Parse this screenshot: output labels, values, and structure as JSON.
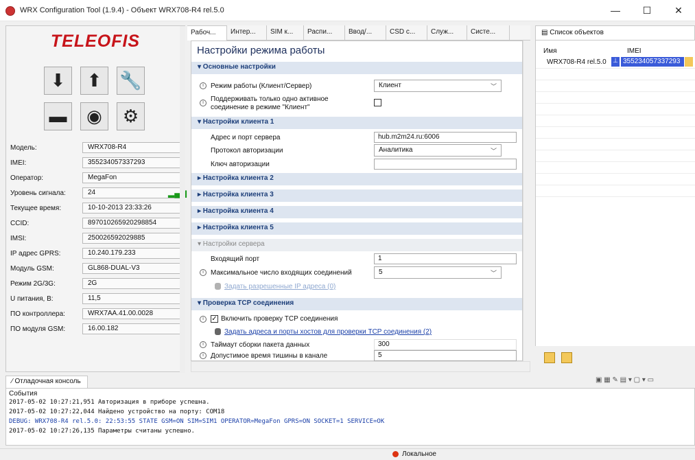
{
  "window": {
    "title": "WRX Configuration Tool (1.9.4) - Объект WRX708-R4 rel.5.0",
    "minimize": "—",
    "maximize": "☐",
    "close": "✕"
  },
  "left_panel": {
    "logo": "TELEOFIS",
    "info": [
      {
        "label": "Модель:",
        "value": "WRX708-R4"
      },
      {
        "label": "IMEI:",
        "value": "355234057337293"
      },
      {
        "label": "Оператор:",
        "value": "MegaFon"
      },
      {
        "label": "Уровень сигнала:",
        "value": "24"
      },
      {
        "label": "Текущее время:",
        "value": "10-10-2013 23:33:26"
      },
      {
        "label": "CCID:",
        "value": "897010265920298854"
      },
      {
        "label": "IMSI:",
        "value": "250026592029885"
      },
      {
        "label": "IP адрес GPRS:",
        "value": "10.240.179.233"
      },
      {
        "label": "Модуль GSM:",
        "value": "GL868-DUAL-V3"
      },
      {
        "label": "Режим 2G/3G:",
        "value": "2G"
      },
      {
        "label": "U питания, В:",
        "value": "11,5"
      },
      {
        "label": "ПО контроллера:",
        "value": "WRX7AA.41.00.0028"
      },
      {
        "label": "ПО модуля GSM:",
        "value": "16.00.182"
      }
    ]
  },
  "tabs": [
    "Рабоч...",
    "Интер...",
    "SIM к...",
    "Распи...",
    "Ввод/...",
    "CSD с...",
    "Служ...",
    "Систе..."
  ],
  "settings": {
    "title": "Настройки режима работы",
    "sections": {
      "basic": "▾ Основные настройки",
      "client1": "▾ Настройки клиента 1",
      "client2": "▸ Настройка клиента 2",
      "client3": "▸ Настройка клиента 3",
      "client4": "▸ Настройка клиента 4",
      "client5": "▸ Настройка клиента 5",
      "server": "▾ Настройки сервера",
      "tcp": "▾ Проверка TCP соединения"
    },
    "mode_label": "Режим работы (Клиент/Сервер)",
    "mode_value": "Клиент",
    "single_conn_label_1": "Поддерживать только одно активное",
    "single_conn_label_2": "соединение в режиме \"Клиент\"",
    "server_address_label": "Адрес и порт сервера",
    "server_address_value": "hub.m2m24.ru:6006",
    "auth_protocol_label": "Протокол авторизации",
    "auth_protocol_value": "Аналитика",
    "auth_key_label": "Ключ авторизации",
    "auth_key_value": "",
    "incoming_port_label": "Входящий порт",
    "incoming_port_value": "1",
    "max_conn_label": "Максимальное число входящих соединений",
    "max_conn_value": "5",
    "allowed_ip_link": "Задать разрешенные IP адреса (0)",
    "tcp_check_label": "Включить проверку TCP соединения",
    "tcp_hosts_link": "Задать адреса и порты хостов для проверки TCP соединения (2)",
    "packet_timeout_label": "Таймаут сборки пакета данных",
    "packet_timeout_value": "300",
    "silence_label": "Допустимое время тишины в канале",
    "silence_value": "5"
  },
  "objects": {
    "title": "Список объектов",
    "col_name": "Имя",
    "col_imei": "IMEI",
    "row_name": "WRX708-R4 rel.5.0",
    "row_imei": "355234057337293"
  },
  "console": {
    "tab": "Отладочная консоль",
    "events": "События",
    "lines": [
      "2017-05-02 10:27:21,951 Авторизация в приборе успешна.",
      "2017-05-02 10:27:22,044 Найдено устройство на порту: COM18",
      "DEBUG: WRX708-R4 rel.5.0: 22:53:55 STATE GSM=ON SIM=SIM1 OPERATOR=MegaFon GPRS=ON SOCKET=1 SERVICE=OK",
      "2017-05-02 10:27:26,135 Параметры считаны успешно."
    ]
  },
  "status": {
    "text": "Локальное"
  },
  "colors": {
    "accent": "#1d3f7a",
    "logo": "#c7141a",
    "section_bg": "#dde5f0",
    "selection": "#3a5bd9"
  }
}
